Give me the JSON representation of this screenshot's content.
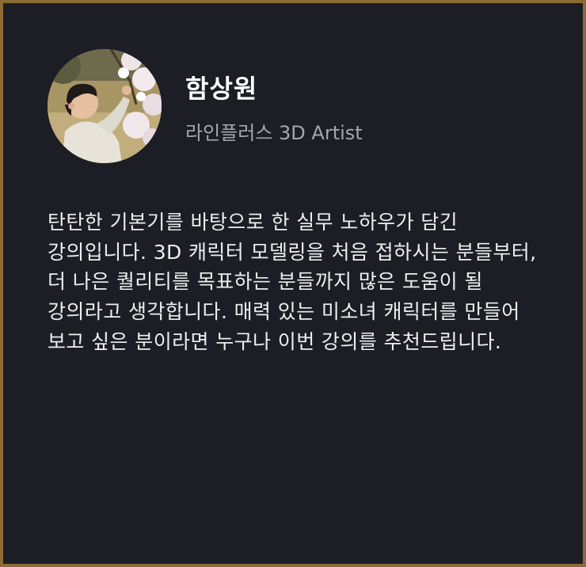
{
  "instructor": {
    "name": "함상원",
    "role": "라인플러스 3D Artist",
    "bio": "탄탄한 기본기를 바탕으로 한 실무 노하우가 담긴 강의입니다. 3D 캐릭터 모델링을 처음 접하시는 분들부터, 더 나은 퀄리티를 목표하는 분들까지 많은 도움이 될 강의라고 생각합니다. 매력 있는 미소녀 캐릭터를 만들어 보고 싶은 분이라면 누구나 이번 강의를 추천드립니다."
  },
  "colors": {
    "frame": "#8a6c35",
    "background": "#1c1d25",
    "name": "#ffffff",
    "role": "#a6a7ad",
    "bio": "#eeeeee"
  }
}
